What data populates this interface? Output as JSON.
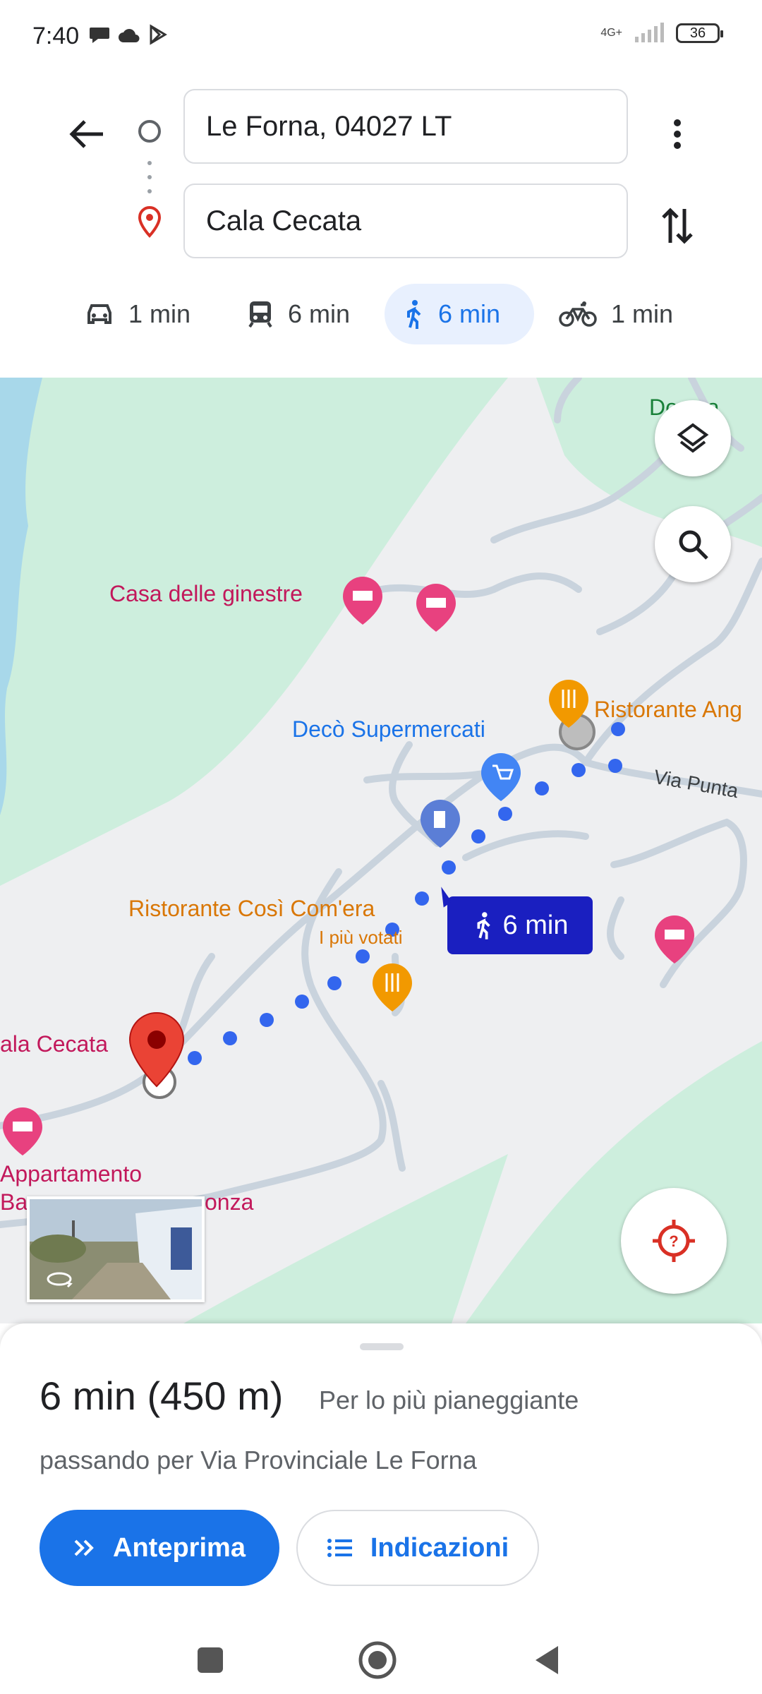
{
  "status_bar": {
    "time": "7:40",
    "network": "4G+",
    "battery": "36"
  },
  "search": {
    "origin": "Le Forna, 04027 LT",
    "destination": "Cala Cecata"
  },
  "modes": [
    {
      "name": "car",
      "label": "1 min",
      "active": false
    },
    {
      "name": "transit",
      "label": "6 min",
      "active": false
    },
    {
      "name": "walk",
      "label": "6 min",
      "active": true
    },
    {
      "name": "bike",
      "label": "1 min",
      "active": false
    }
  ],
  "map": {
    "labels": {
      "dogana": "Do   zza",
      "casa_ginestre": "Casa delle ginestre",
      "deco": "Decò Supermercati",
      "ristorante_ang": "Ristorante Ang",
      "via_punta": "Via Punta",
      "cosi_comera": "Ristorante Così Com'era",
      "piu_votati": "I più votati",
      "cala_cecata": "ala Cecata",
      "appartamento": "Appartamento",
      "ba": "Ba",
      "onza": "onza"
    },
    "route_time": "6 min"
  },
  "sheet": {
    "duration": "6 min (450 m)",
    "terrain": "Per lo più pianeggiante",
    "via": "passando per Via Provinciale Le Forna",
    "preview_label": "Anteprima",
    "directions_label": "Indicazioni"
  },
  "colors": {
    "accent": "#1a73e8",
    "route_dots": "#3366ee",
    "park_green": "#cdeedd",
    "water": "#a8d8ea",
    "pin_red": "#d93025"
  }
}
